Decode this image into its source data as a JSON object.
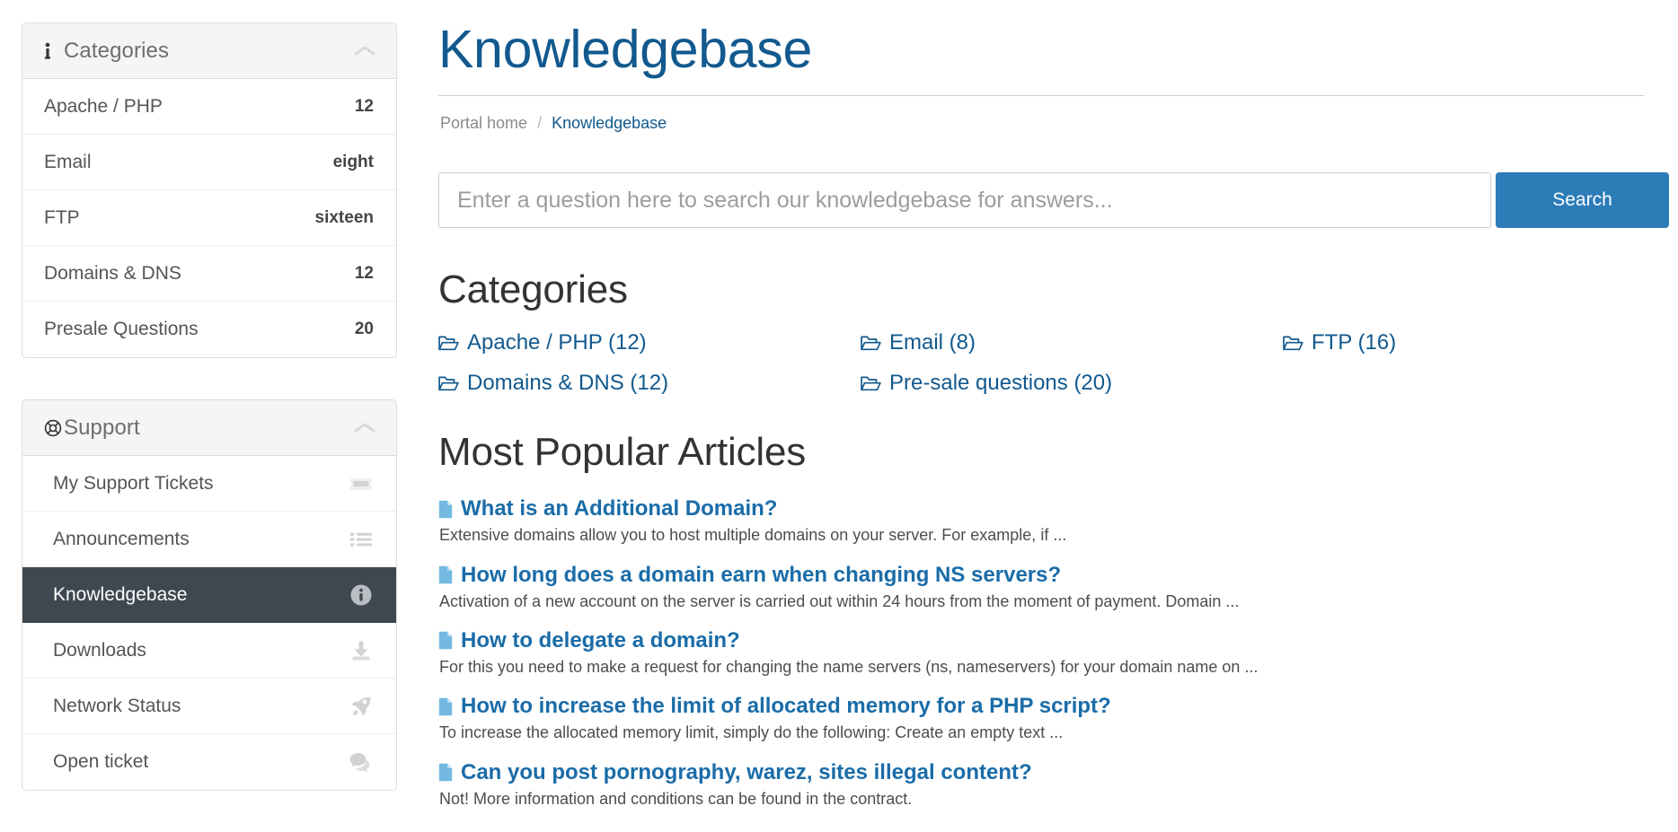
{
  "sidebar": {
    "categories_panel": {
      "title": "Categories",
      "icon": "info-icon",
      "collapse_icon": "chevron-up-icon",
      "items": [
        {
          "label": "Apache / PHP",
          "count": "12"
        },
        {
          "label": "Email",
          "count": "eight"
        },
        {
          "label": "FTP",
          "count": "sixteen"
        },
        {
          "label": "Domains & DNS",
          "count": "12"
        },
        {
          "label": "Presale Questions",
          "count": "20"
        }
      ]
    },
    "support_panel": {
      "title": "Support",
      "icon": "life-ring-icon",
      "collapse_icon": "chevron-up-icon",
      "items": [
        {
          "label": "My Support Tickets",
          "icon": "ticket-icon",
          "active": false
        },
        {
          "label": "Announcements",
          "icon": "list-icon",
          "active": false
        },
        {
          "label": "Knowledgebase",
          "icon": "info-circle-icon",
          "active": true
        },
        {
          "label": "Downloads",
          "icon": "download-icon",
          "active": false
        },
        {
          "label": "Network Status",
          "icon": "rocket-icon",
          "active": false
        },
        {
          "label": "Open ticket",
          "icon": "comments-icon",
          "active": false
        }
      ]
    }
  },
  "main": {
    "page_title": "Knowledgebase",
    "breadcrumb": {
      "home": "Portal home",
      "separator": "/",
      "current": "Knowledgebase"
    },
    "search": {
      "placeholder": "Enter a question here to search our knowledgebase for answers...",
      "value": "",
      "button_label": "Search"
    },
    "categories_section": {
      "title": "Categories",
      "links": [
        "Apache / PHP (12)",
        "Email (8)",
        "FTP (16)",
        "Domains & DNS (12)",
        "Pre-sale questions (20)"
      ]
    },
    "popular_section": {
      "title": "Most Popular Articles",
      "articles": [
        {
          "title": "What is an Additional Domain?",
          "excerpt": "Extensive domains allow you to host multiple domains on your server. For example, if ..."
        },
        {
          "title": "How long does a domain earn when changing NS servers?",
          "excerpt": "Activation of a new account on the server is carried out within 24 hours from the moment of payment. Domain ..."
        },
        {
          "title": "How to delegate a domain?",
          "excerpt": "For this you need to make a request for changing the name servers (ns, nameservers) for your domain name on ..."
        },
        {
          "title": "How to increase the limit of allocated memory for a PHP script?",
          "excerpt": "To increase the allocated memory limit, simply do the following: Create an empty text ..."
        },
        {
          "title": "Can you post pornography, warez, sites illegal content?",
          "excerpt": "Not! More information and conditions can be found in the contract."
        }
      ]
    }
  },
  "colors": {
    "title_blue": "#11598e",
    "link_blue": "#1a6ca8",
    "button_blue": "#2c7cb8",
    "active_nav_bg": "#3f4851",
    "panel_head_bg": "#f5f5f5",
    "file_icon_blue": "#74b9e0"
  }
}
